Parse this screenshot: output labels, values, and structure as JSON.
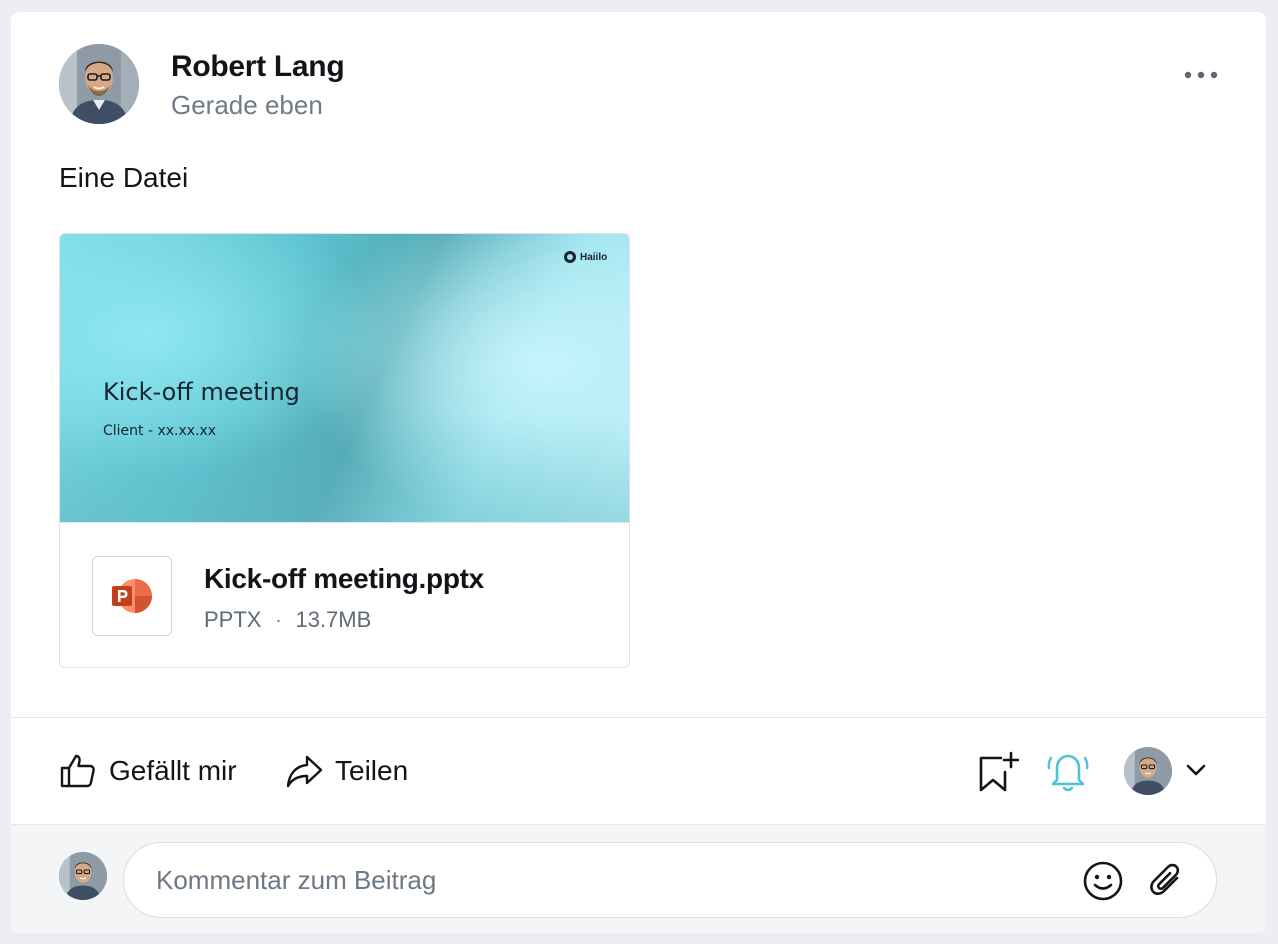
{
  "post": {
    "author": "Robert Lang",
    "time": "Gerade eben",
    "text": "Eine Datei"
  },
  "attachment": {
    "slide_title": "Kick-off meeting",
    "slide_subtitle": "Client - xx.xx.xx",
    "slide_logo": "Haiilo",
    "file_name": "Kick-off meeting.pptx",
    "file_type": "PPTX",
    "separator": "·",
    "file_size": "13.7MB",
    "file_icon": "powerpoint-icon"
  },
  "actions": {
    "like_label": "Gefällt mir",
    "share_label": "Teilen",
    "like_icon": "thumbs-up-icon",
    "share_icon": "share-arrow-icon",
    "bookmark_icon": "bookmark-add-icon",
    "bell_icon": "bell-icon",
    "bell_color": "#4ec3d6"
  },
  "comment": {
    "placeholder": "Kommentar zum Beitrag",
    "emoji_icon": "smiley-icon",
    "attach_icon": "paperclip-icon"
  },
  "colors": {
    "background": "#eceef1",
    "muted_text": "#707b88",
    "powerpoint": "#d24726"
  }
}
